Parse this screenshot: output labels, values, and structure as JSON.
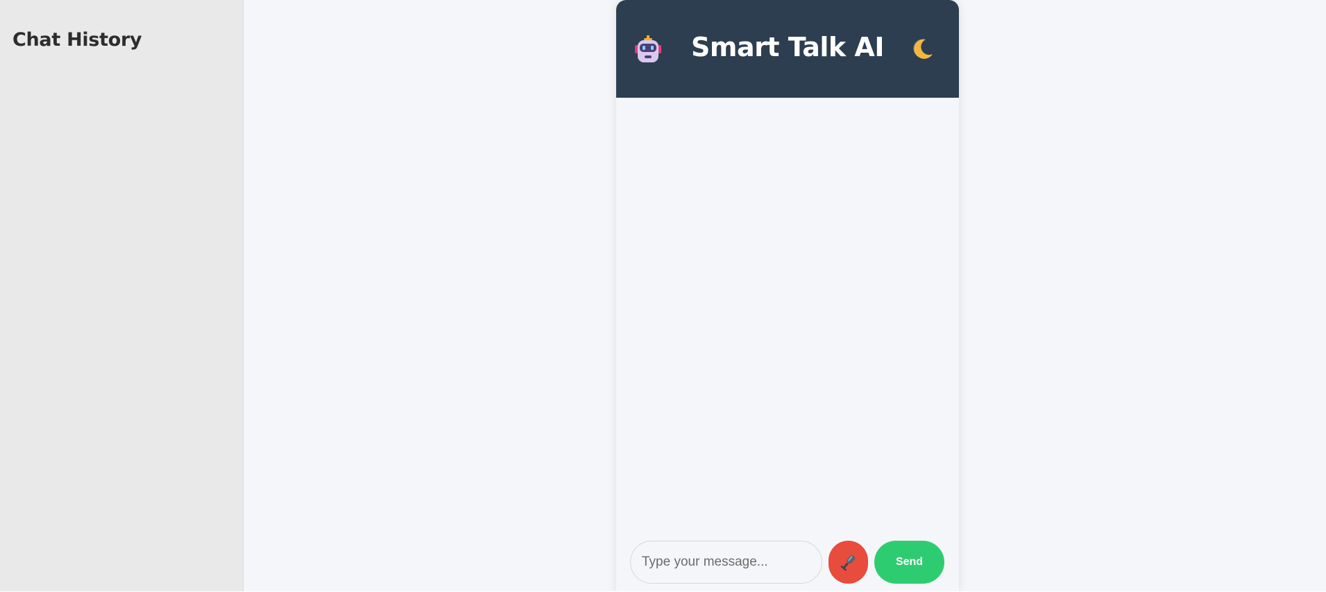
{
  "sidebar": {
    "title": "Chat History"
  },
  "header": {
    "title": "Smart Talk AI",
    "avatar_icon": "robot-icon",
    "theme_toggle_icon": "moon-icon"
  },
  "composer": {
    "placeholder": "Type your message...",
    "value": "",
    "mic_icon": "microphone-icon",
    "send_label": "Send"
  },
  "colors": {
    "header_bg": "#2c3e50",
    "mic_bg": "#e74c3c",
    "send_bg": "#2ecc71",
    "sidebar_bg": "#e9e9e9",
    "page_bg": "#f4f6f9"
  }
}
